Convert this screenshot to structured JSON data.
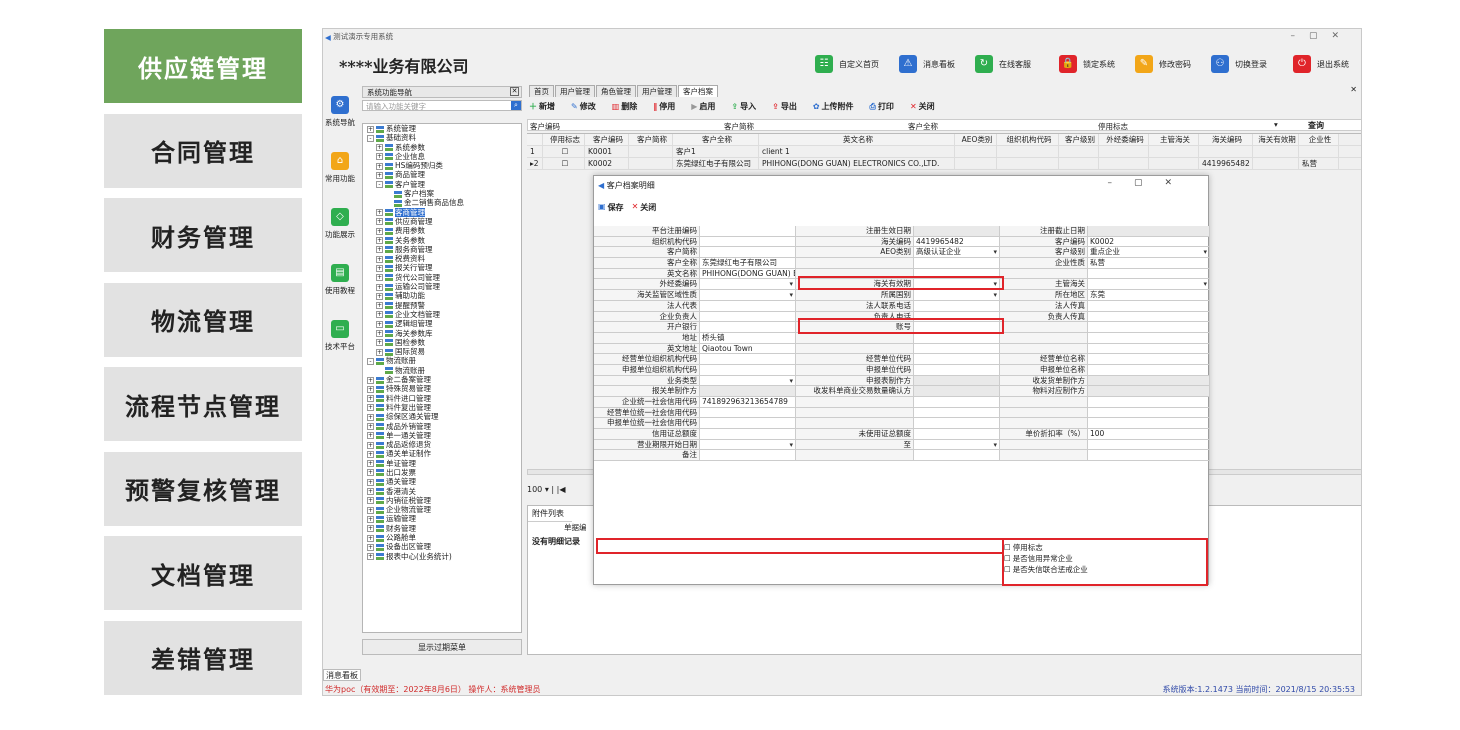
{
  "left_nav": [
    {
      "label": "供应链管理",
      "active": true
    },
    {
      "label": "合同管理"
    },
    {
      "label": "财务管理"
    },
    {
      "label": "物流管理"
    },
    {
      "label": "流程节点管理"
    },
    {
      "label": "预警复核管理"
    },
    {
      "label": "文档管理"
    },
    {
      "label": "差错管理"
    }
  ],
  "app": {
    "window_title": "测试演示专用系统",
    "company": "****业务有限公司",
    "header_buttons": [
      "自定义首页",
      "消息看板",
      "在线客服",
      "锁定系统",
      "修改密码",
      "切换登录",
      "退出系统"
    ],
    "side_tabs": [
      "系统导航",
      "常用功能",
      "功能展示",
      "使用教程",
      "技术平台"
    ],
    "nav_title": "系统功能导航",
    "search_placeholder": "请输入功能关键字",
    "tree": [
      {
        "t": "系统管理",
        "lv": 1,
        "ex": "+"
      },
      {
        "t": "基础资料",
        "lv": 1,
        "ex": "-"
      },
      {
        "t": "系统参数",
        "lv": 2,
        "ex": "+"
      },
      {
        "t": "企业信息",
        "lv": 2,
        "ex": "+"
      },
      {
        "t": "HS编码预归类",
        "lv": 2,
        "ex": "+"
      },
      {
        "t": "商品管理",
        "lv": 2,
        "ex": "+"
      },
      {
        "t": "客户管理",
        "lv": 2,
        "ex": "-"
      },
      {
        "t": "客户档案",
        "lv": 3
      },
      {
        "t": "金二销售商品信息",
        "lv": 3
      },
      {
        "t": "客商管理",
        "lv": 2,
        "ex": "+",
        "sel": true
      },
      {
        "t": "供应商管理",
        "lv": 2,
        "ex": "+"
      },
      {
        "t": "费用参数",
        "lv": 2,
        "ex": "+"
      },
      {
        "t": "关务参数",
        "lv": 2,
        "ex": "+"
      },
      {
        "t": "服务商管理",
        "lv": 2,
        "ex": "+"
      },
      {
        "t": "税费资料",
        "lv": 2,
        "ex": "+"
      },
      {
        "t": "报关行管理",
        "lv": 2,
        "ex": "+"
      },
      {
        "t": "货代公司管理",
        "lv": 2,
        "ex": "+"
      },
      {
        "t": "运输公司管理",
        "lv": 2,
        "ex": "+"
      },
      {
        "t": "辅助功能",
        "lv": 2,
        "ex": "+"
      },
      {
        "t": "提醒预警",
        "lv": 2,
        "ex": "+"
      },
      {
        "t": "企业文档管理",
        "lv": 2,
        "ex": "+"
      },
      {
        "t": "逻辑组管理",
        "lv": 2,
        "ex": "+"
      },
      {
        "t": "海关参数库",
        "lv": 2,
        "ex": "+"
      },
      {
        "t": "国检参数",
        "lv": 2,
        "ex": "+"
      },
      {
        "t": "国际贸易",
        "lv": 2,
        "ex": "+"
      },
      {
        "t": "物流账册",
        "lv": 1,
        "ex": "-"
      },
      {
        "t": "物流账册",
        "lv": 2
      },
      {
        "t": "金二备案管理",
        "lv": 1,
        "ex": "+"
      },
      {
        "t": "特殊贸易管理",
        "lv": 1,
        "ex": "+"
      },
      {
        "t": "料件进口管理",
        "lv": 1,
        "ex": "+"
      },
      {
        "t": "料件复出管理",
        "lv": 1,
        "ex": "+"
      },
      {
        "t": "综保区通关管理",
        "lv": 1,
        "ex": "+"
      },
      {
        "t": "成品外销管理",
        "lv": 1,
        "ex": "+"
      },
      {
        "t": "单一通关管理",
        "lv": 1,
        "ex": "+"
      },
      {
        "t": "成品返修退货",
        "lv": 1,
        "ex": "+"
      },
      {
        "t": "通关单证制作",
        "lv": 1,
        "ex": "+"
      },
      {
        "t": "单证管理",
        "lv": 1,
        "ex": "+"
      },
      {
        "t": "出口发票",
        "lv": 1,
        "ex": "+"
      },
      {
        "t": "通关管理",
        "lv": 1,
        "ex": "+"
      },
      {
        "t": "香港清关",
        "lv": 1,
        "ex": "+"
      },
      {
        "t": "内销征税管理",
        "lv": 1,
        "ex": "+"
      },
      {
        "t": "企业物流管理",
        "lv": 1,
        "ex": "+"
      },
      {
        "t": "运输管理",
        "lv": 1,
        "ex": "+"
      },
      {
        "t": "财务管理",
        "lv": 1,
        "ex": "+"
      },
      {
        "t": "公路舱单",
        "lv": 1,
        "ex": "+"
      },
      {
        "t": "设备出区管理",
        "lv": 1,
        "ex": "+"
      },
      {
        "t": "报表中心(业务统计)",
        "lv": 1,
        "ex": "+"
      }
    ],
    "show_expired": "显示过期菜单",
    "tabs": [
      "首页",
      "用户管理",
      "角色管理",
      "用户管理",
      "客户档案"
    ],
    "toolbar": [
      "新增",
      "修改",
      "删除",
      "停用",
      "启用",
      "导入",
      "导出",
      "上传附件",
      "打印",
      "关闭"
    ],
    "filter": {
      "code": "客户编码",
      "short": "客户简称",
      "full": "客户全称",
      "stop": "停用标志",
      "query": "查询"
    },
    "grid_headers": [
      "",
      "停用标志",
      "客户编码",
      "客户简称",
      "客户全称",
      "英文名称",
      "AEO类别",
      "组织机构代码",
      "客户级别",
      "外经委编码",
      "主管海关",
      "海关编码",
      "海关有效期",
      "企业性"
    ],
    "rows": [
      [
        "1",
        "",
        "K0001",
        "",
        "客户1",
        "client 1",
        "",
        "",
        "",
        "",
        "",
        "",
        "",
        ""
      ],
      [
        "▸2",
        "",
        "K0002",
        "",
        "东莞绿红电子有限公司",
        "PHIHONG(DONG GUAN) ELECTRONICS CO.,LTD.",
        "",
        "",
        "",
        "",
        "",
        "4419965482",
        "",
        "私营"
      ]
    ],
    "pager": "100",
    "attach_title": "附件列表",
    "attach_col": "单据编",
    "no_detail": "没有明细记录",
    "message_board": "消息看板",
    "status_left": "华为poc（有效期至：2022年8月6日）   操作人：系统管理员",
    "status_right": "系统版本:1.2.1473  当前时间：2021/8/15 20:35:53"
  },
  "dialog": {
    "title": "客户档案明细",
    "save": "保存",
    "close": "关闭",
    "rows": [
      [
        "平台注册编码",
        "",
        "注册生效日期",
        "",
        "注册截止日期",
        ""
      ],
      [
        "组织机构代码",
        "",
        "海关编码",
        "4419965482",
        "客户编码",
        "K0002"
      ],
      [
        "客户简称",
        "",
        "AEO类别",
        "高级认证企业",
        "客户级别",
        "重点企业"
      ],
      [
        "客户全称",
        "东莞绿红电子有限公司",
        "",
        "",
        "企业性质",
        "私营"
      ],
      [
        "英文名称",
        "PHIHONG(DONG GUAN) ELECTRONICS CO.,LTD.",
        "",
        "",
        "",
        ""
      ],
      [
        "外经委编码",
        "",
        "海关有效期",
        "",
        "主管海关",
        ""
      ],
      [
        "海关监管区域性质",
        "",
        "所属国别",
        "",
        "所在地区",
        "东莞"
      ],
      [
        "法人代表",
        "",
        "法人联系电话",
        "",
        "法人传真",
        ""
      ],
      [
        "企业负责人",
        "",
        "负责人电话",
        "",
        "负责人传真",
        ""
      ],
      [
        "开户银行",
        "",
        "账号",
        "",
        "",
        ""
      ],
      [
        "地址",
        "桥头镇",
        "",
        "",
        "",
        ""
      ],
      [
        "英文地址",
        "Qiaotou Town",
        "",
        "",
        "",
        ""
      ],
      [
        "经营单位组织机构代码",
        "",
        "经营单位代码",
        "",
        "经营单位名称",
        ""
      ],
      [
        "申报单位组织机构代码",
        "",
        "申报单位代码",
        "",
        "申报单位名称",
        ""
      ],
      [
        "业务类型",
        "",
        "申报表制作方",
        "",
        "收发货单制作方",
        ""
      ],
      [
        "报关单制作方",
        "",
        "收发料单商业交易数量确认方",
        "",
        "物料对应制作方",
        ""
      ],
      [
        "企业统一社会信用代码",
        "741892963213654789",
        "",
        "",
        "",
        ""
      ],
      [
        "经营单位统一社会信用代码",
        "",
        "",
        "",
        "",
        ""
      ],
      [
        "申报单位统一社会信用代码",
        "",
        "",
        "",
        "",
        ""
      ],
      [
        "信用证总额度",
        "",
        "未使用证总额度",
        "",
        "单价折扣率（%）",
        "100"
      ],
      [
        "营业期限开始日期",
        "",
        "至",
        "",
        "",
        ""
      ],
      [
        "备注",
        "",
        "",
        "",
        "",
        ""
      ]
    ],
    "checks": [
      "停用标志",
      "是否信用异常企业",
      "是否失信联合惩戒企业"
    ]
  }
}
